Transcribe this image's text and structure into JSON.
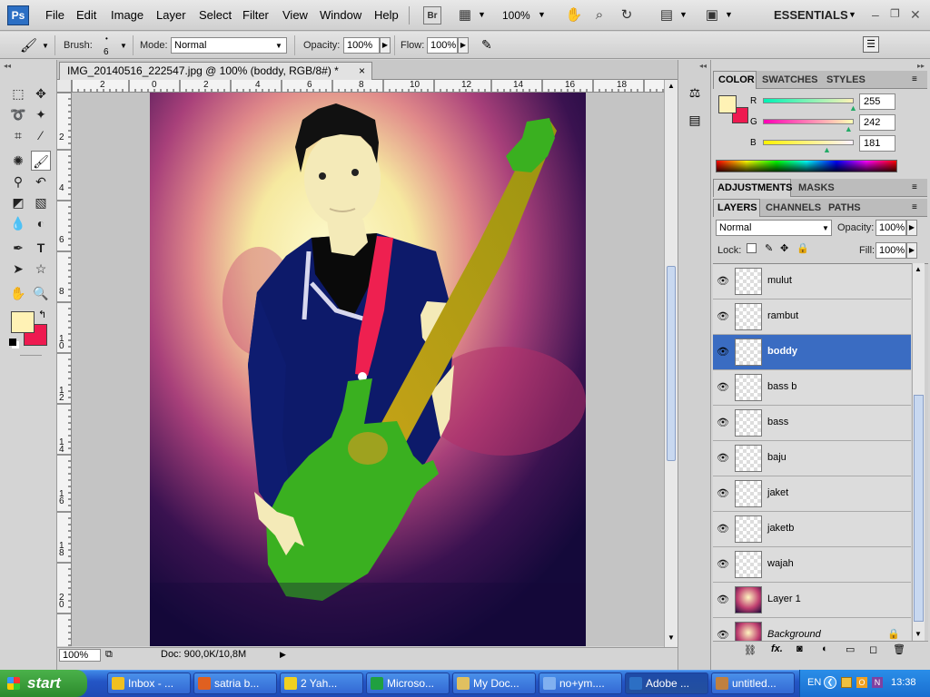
{
  "app": {
    "logo": "Ps",
    "workspace": "ESSENTIALS",
    "zoom": "100%"
  },
  "menu": [
    "File",
    "Edit",
    "Image",
    "Layer",
    "Select",
    "Filter",
    "View",
    "Window",
    "Help"
  ],
  "appbar_icons": [
    "bridge-icon",
    "mini-bridge-icon",
    "hand-icon",
    "zoom-icon",
    "rotate-view-icon",
    "arrange-documents-icon",
    "screen-mode-icon"
  ],
  "options": {
    "brush_label": "Brush:",
    "brush_size": "6",
    "mode_label": "Mode:",
    "mode_value": "Normal",
    "opacity_label": "Opacity:",
    "opacity_value": "100%",
    "flow_label": "Flow:",
    "flow_value": "100%"
  },
  "document": {
    "tab_title": "IMG_20140516_222547.jpg @ 100% (boddy, RGB/8#) *",
    "close": "×"
  },
  "rulers": {
    "horizontal": [
      "2",
      "0",
      "2",
      "4",
      "6",
      "8",
      "10",
      "12",
      "14",
      "16",
      "18"
    ],
    "vertical": [
      "2",
      "4",
      "6",
      "8",
      "1\n0",
      "1\n2",
      "1\n4",
      "1\n6",
      "1\n8",
      "2\n0"
    ]
  },
  "status": {
    "zoom": "100%",
    "doc": "Doc: 900,0K/10,8M"
  },
  "color_panel": {
    "tabs": [
      "COLOR",
      "SWATCHES",
      "STYLES"
    ],
    "channels": [
      {
        "label": "R",
        "value": "255",
        "level": 1.0
      },
      {
        "label": "G",
        "value": "242",
        "level": 0.949
      },
      {
        "label": "B",
        "value": "181",
        "level": 0.71
      }
    ],
    "foreground": "#fff2b5",
    "background": "#ee1a50"
  },
  "adjustments_panel": {
    "tabs": [
      "ADJUSTMENTS",
      "MASKS"
    ]
  },
  "layers_panel": {
    "tabs": [
      "LAYERS",
      "CHANNELS",
      "PATHS"
    ],
    "blend_mode": "Normal",
    "opacity_label": "Opacity:",
    "opacity_value": "100%",
    "lock_label": "Lock:",
    "fill_label": "Fill:",
    "fill_value": "100%",
    "layers": [
      {
        "name": "mulut",
        "selected": false
      },
      {
        "name": "rambut",
        "selected": false
      },
      {
        "name": "boddy",
        "selected": true
      },
      {
        "name": "bass b",
        "selected": false
      },
      {
        "name": "bass",
        "selected": false
      },
      {
        "name": "baju",
        "selected": false
      },
      {
        "name": "jaket",
        "selected": false
      },
      {
        "name": "jaketb",
        "selected": false
      },
      {
        "name": "wajah",
        "selected": false
      },
      {
        "name": "Layer 1",
        "selected": false
      },
      {
        "name": "Background",
        "selected": false
      }
    ]
  },
  "taskbar": {
    "start": "start",
    "tasks": [
      {
        "label": "Inbox - ...",
        "color": "#f0c020"
      },
      {
        "label": "satria b...",
        "color": "#e06020"
      },
      {
        "label": "2 Yah...",
        "color": "#f0d020"
      },
      {
        "label": "Microso...",
        "color": "#20a040"
      },
      {
        "label": "My Doc...",
        "color": "#e0c060"
      },
      {
        "label": "no+ym....",
        "color": "#80b0f0"
      },
      {
        "label": "Adobe ...",
        "color": "#2c6fc4"
      },
      {
        "label": "untitled...",
        "color": "#c08040"
      }
    ],
    "lang": "EN",
    "clock": "13:38"
  }
}
